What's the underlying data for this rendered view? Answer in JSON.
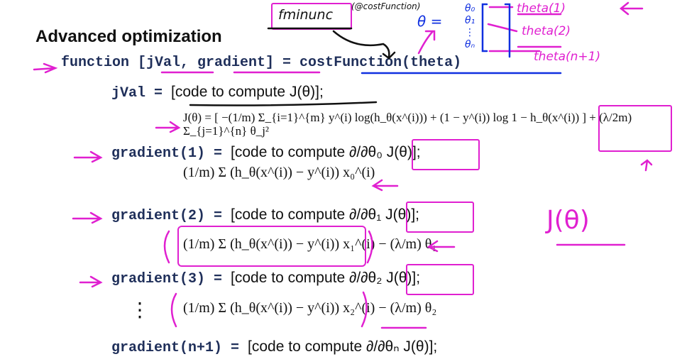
{
  "slide": {
    "title": "Advanced optimization",
    "signature": "function [jVal, gradient] = costFunction(theta)",
    "jval_line": {
      "code": "jVal = ",
      "text": "[code to compute J(θ)];"
    },
    "cost_formula": "J(θ) = [ −(1/m) Σ_{i=1}^{m} y^(i) log(h_θ(x^(i))) + (1 − y^(i)) log 1 − h_θ(x^(i)) ] + (λ/2m) Σ_{j=1}^{n} θ_j²",
    "gradients": [
      {
        "code": "gradient(1) = ",
        "text": "[code to compute ∂/∂θ₀ J(θ)];",
        "formula": "(1/m) Σ (h_θ(x^(i)) − y^(i)) x₀^(i)"
      },
      {
        "code": "gradient(2) = ",
        "text": "[code to compute ∂/∂θ₁ J(θ)];",
        "formula": "(1/m) Σ (h_θ(x^(i)) − y^(i)) x₁^(i) − (λ/m) θ₁"
      },
      {
        "code": "gradient(3) = ",
        "text": "[code to compute ∂/∂θ₂ J(θ)];",
        "formula": "(1/m) Σ (h_θ(x^(i)) − y^(i)) x₂^(i) − (λ/m) θ₂"
      },
      {
        "code": "gradient(n+1) = ",
        "text": "[code to compute ∂/∂θₙ J(θ)];"
      }
    ],
    "ellipsis": "⋮"
  },
  "annotations": {
    "fminunc": "fminunc",
    "costfn_handle": "(@costFunction)",
    "theta_eq": "θ =",
    "theta_vector": [
      "θ₀",
      "θ₁",
      "⋮",
      "θₙ"
    ],
    "theta_labels": [
      "theta(1)",
      "theta(2)",
      "theta(n+1)"
    ],
    "j_theta": "J(θ)",
    "ink_colors": {
      "magenta": "#e020d0",
      "blue": "#1030e0",
      "black": "#111111"
    }
  }
}
